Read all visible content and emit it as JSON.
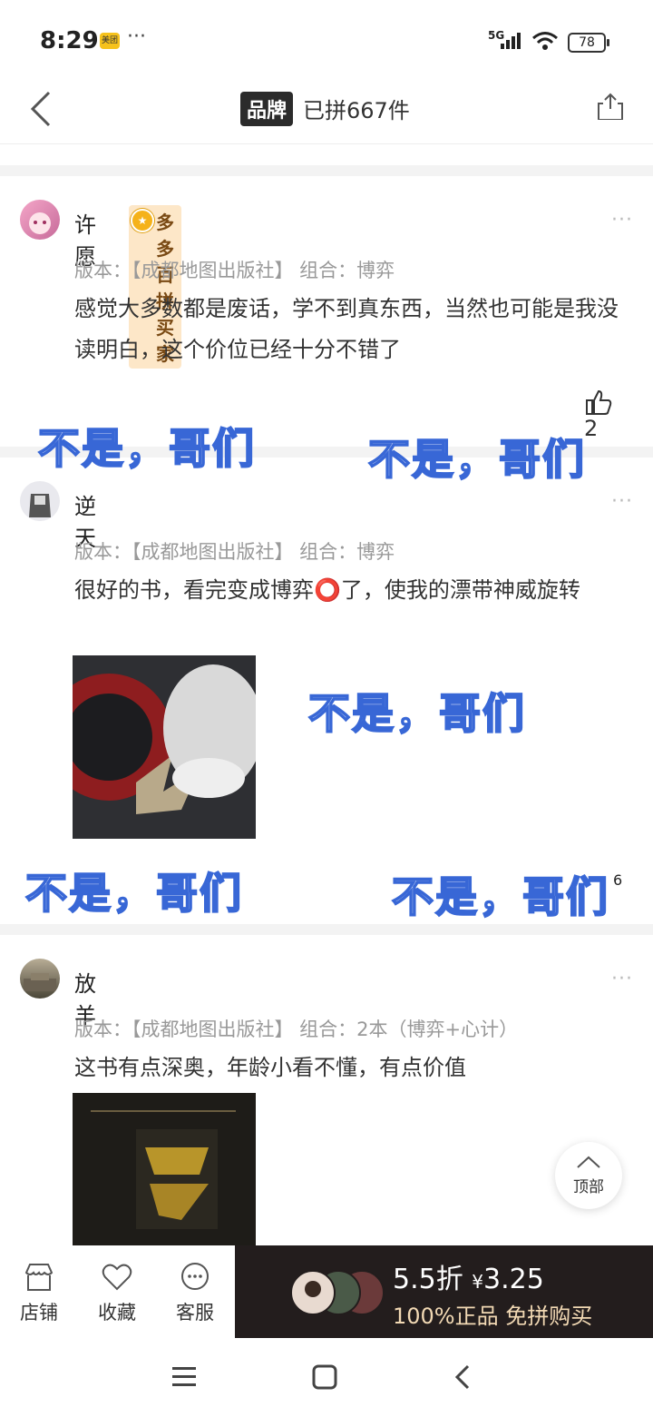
{
  "status_bar": {
    "time": "8:29",
    "app_badge": "美团",
    "dots": "···",
    "network": "5G",
    "battery": "78"
  },
  "header": {
    "brand_tag": "品牌",
    "sold_text": "已拼667件"
  },
  "reviews": [
    {
      "user": "许愿",
      "badge": "多多百拼买家",
      "meta": "版本：【成都地图出版社】 组合：博弈",
      "text": "感觉大多数都是废话，学不到真东西，当然也可能是我没读明白，这个价位已经十分不错了",
      "likes": "2"
    },
    {
      "user": "逆天",
      "meta": "版本：【成都地图出版社】 组合：博弈",
      "text": "很好的书，看完变成博弈⭕了，使我的漂带神威旋转",
      "likes": "6"
    },
    {
      "user": "放羊",
      "meta": "版本：【成都地图出版社】 组合：2本（博弈+心计）",
      "text": "这书有点深奥，年龄小看不懂，有点价值"
    }
  ],
  "overlay_text": "不是，哥们",
  "more_icon": "···",
  "top_button": "顶部",
  "bottom_bar": {
    "tabs": [
      "店铺",
      "收藏",
      "客服"
    ],
    "discount": "5.5折",
    "price_symbol": "¥",
    "price": "3.25",
    "subtitle": "100%正品 免拼购买"
  },
  "colors": {
    "overlay_stroke": "#3867d6",
    "buy_bg": "#231d1d",
    "badge_bg": "#fde7c8"
  }
}
